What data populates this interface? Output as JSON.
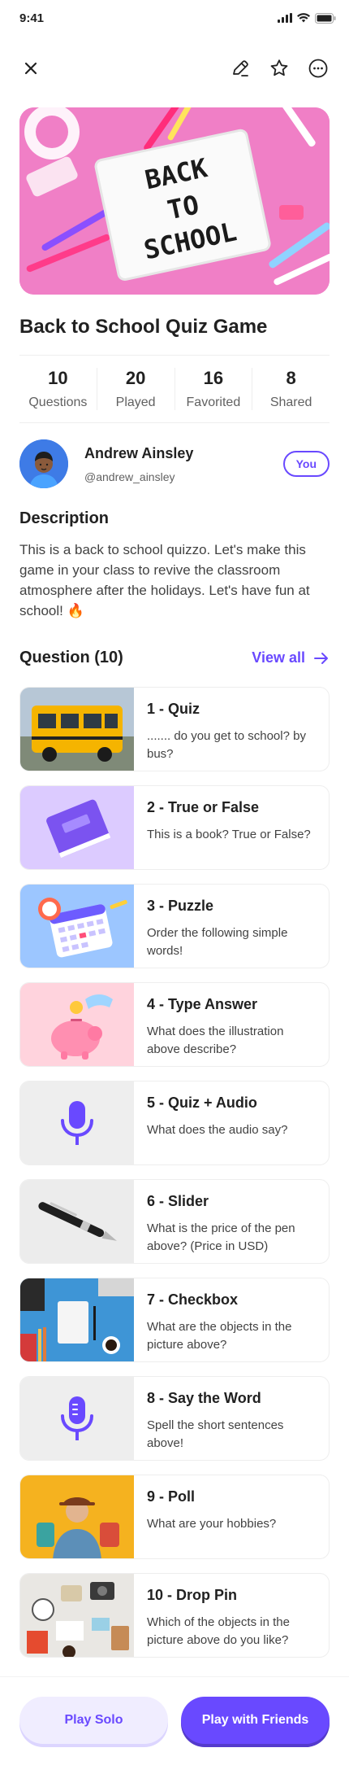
{
  "status": {
    "time": "9:41"
  },
  "quiz": {
    "cover_text": [
      "BACK",
      "TO",
      "SCHOOL"
    ],
    "title": "Back to School Quiz Game",
    "stats": [
      {
        "value": "10",
        "label": "Questions"
      },
      {
        "value": "20",
        "label": "Played"
      },
      {
        "value": "16",
        "label": "Favorited"
      },
      {
        "value": "8",
        "label": "Shared"
      }
    ]
  },
  "author": {
    "name": "Andrew Ainsley",
    "handle": "@andrew_ainsley",
    "badge": "You"
  },
  "description": {
    "heading": "Description",
    "text": "This is a back to school quizzo. Let's make this game in your class to revive the classroom atmosphere after the holidays. Let's have fun at school! 🔥"
  },
  "questions_section": {
    "title": "Question (10)",
    "view_all": "View all"
  },
  "questions": [
    {
      "title": "1 - Quiz",
      "desc": "....... do you get to school? by bus?",
      "thumb": "school-bus"
    },
    {
      "title": "2 - True or False",
      "desc": "This is a book? True or False?",
      "thumb": "book"
    },
    {
      "title": "3 - Puzzle",
      "desc": "Order the following simple words!",
      "thumb": "calendar"
    },
    {
      "title": "4 - Type Answer",
      "desc": "What does the illustration above describe?",
      "thumb": "piggy-bank"
    },
    {
      "title": "5 - Quiz + Audio",
      "desc": "What does the audio say?",
      "thumb": "microphone"
    },
    {
      "title": "6 - Slider",
      "desc": "What is the price of the pen above? (Price in USD)",
      "thumb": "pen"
    },
    {
      "title": "7 - Checkbox",
      "desc": "What are the objects in the picture above?",
      "thumb": "desk-objects"
    },
    {
      "title": "8 - Say the Word",
      "desc": "Spell the short sentences above!",
      "thumb": "microphone-voice"
    },
    {
      "title": "9 - Poll",
      "desc": "What are your hobbies?",
      "thumb": "traveler"
    },
    {
      "title": "10 - Drop Pin",
      "desc": "Which of the objects in the picture above do you like?",
      "thumb": "flatlay"
    }
  ],
  "actions": {
    "solo": "Play Solo",
    "friends": "Play with Friends"
  },
  "colors": {
    "primary": "#6949ff",
    "primary_light": "#f0edff",
    "hero_pink": "#f07fc6"
  }
}
